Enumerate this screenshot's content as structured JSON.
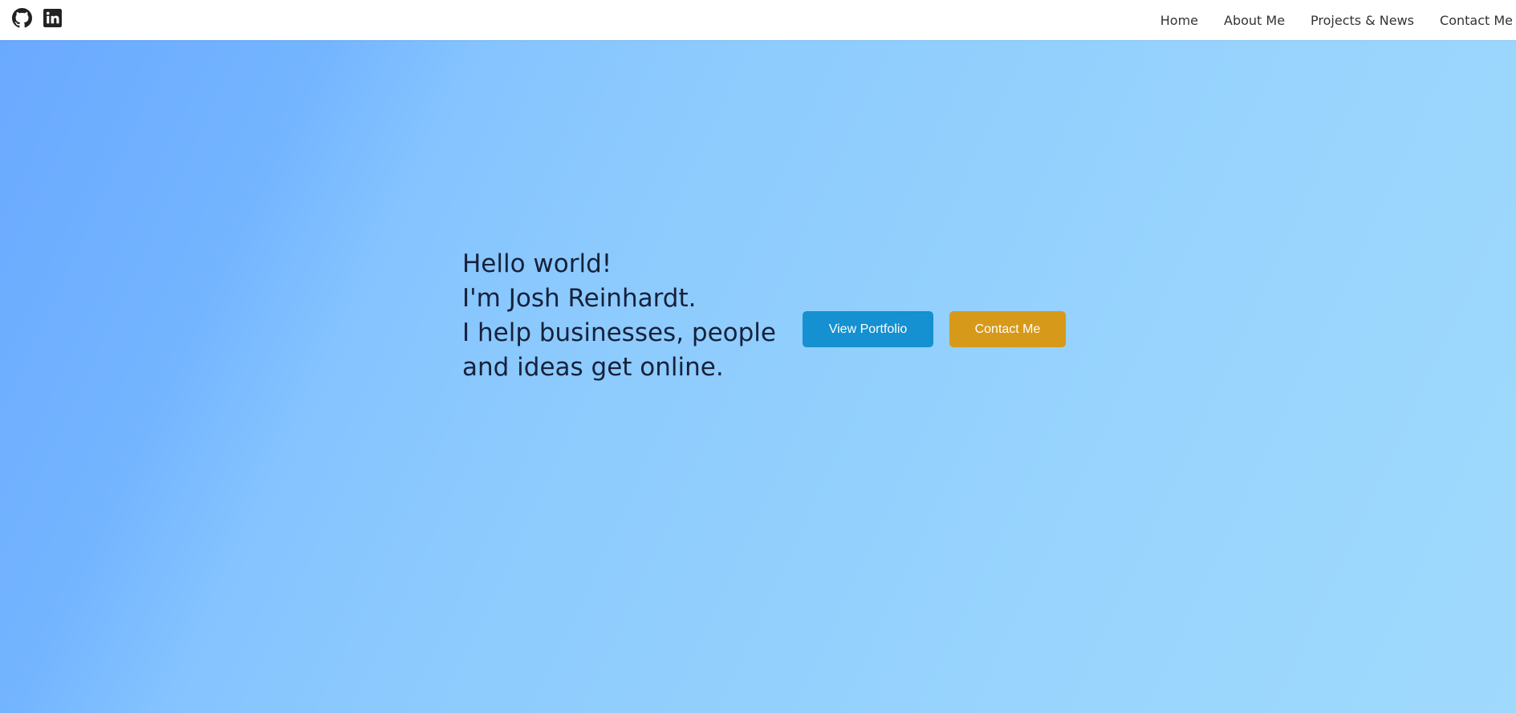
{
  "nav": {
    "social_icons": [
      "github-icon",
      "linkedin-icon"
    ],
    "links": [
      "Home",
      "About Me",
      "Projects & News",
      "Contact Me"
    ]
  },
  "hero": {
    "lines": [
      "Hello world!",
      "I'm Josh Reinhardt.",
      "I help businesses, people",
      "and ideas get online."
    ],
    "buttons": {
      "portfolio": "View Portfolio",
      "contact": "Contact Me"
    }
  },
  "colors": {
    "nav_background": "#ffffff",
    "portfolio_button": "#1590d0",
    "contact_button": "#d6991a",
    "hero_gradient_start": "#6aa9ff",
    "hero_gradient_end": "#9fd9fd",
    "text": "#16213b"
  }
}
